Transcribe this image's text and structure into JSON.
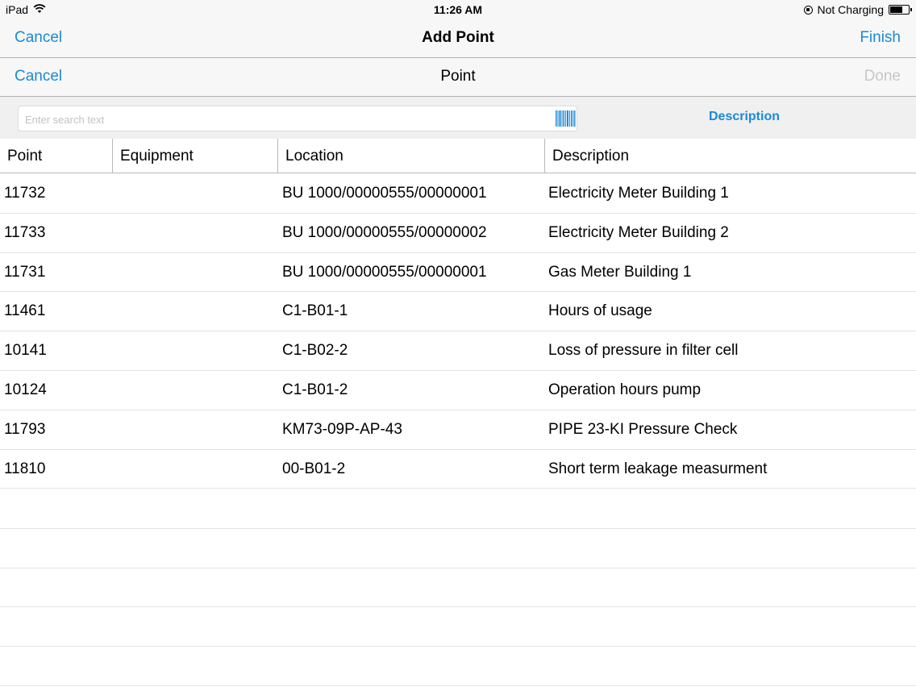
{
  "status_bar": {
    "device": "iPad",
    "time": "11:26 AM",
    "charging": "Not Charging",
    "icons": [
      "wifi-icon",
      "rotation-lock-icon",
      "battery-icon"
    ]
  },
  "nav_primary": {
    "left_button": "Cancel",
    "title": "Add Point",
    "right_button": "Finish"
  },
  "nav_secondary": {
    "left_button": "Cancel",
    "title": "Point",
    "right_button": "Done"
  },
  "search": {
    "placeholder": "Enter search text",
    "value": "",
    "scope_button": "Description",
    "scan_icon": "barcode-icon"
  },
  "table": {
    "columns": [
      "Point",
      "Equipment",
      "Location",
      "Description"
    ],
    "rows": [
      {
        "point": "11732",
        "equipment": "",
        "location": "BU 1000/00000555/00000001",
        "description": "Electricity Meter Building 1"
      },
      {
        "point": "11733",
        "equipment": "",
        "location": "BU 1000/00000555/00000002",
        "description": "Electricity Meter Building 2"
      },
      {
        "point": "11731",
        "equipment": "",
        "location": "BU 1000/00000555/00000001",
        "description": "Gas Meter Building 1"
      },
      {
        "point": "11461",
        "equipment": "",
        "location": "C1-B01-1",
        "description": "Hours of usage"
      },
      {
        "point": "10141",
        "equipment": "",
        "location": "C1-B02-2",
        "description": "Loss of pressure in filter cell"
      },
      {
        "point": "10124",
        "equipment": "",
        "location": "C1-B01-2",
        "description": "Operation hours pump"
      },
      {
        "point": "11793",
        "equipment": "",
        "location": "KM73-09P-AP-43",
        "description": "PIPE 23-KI Pressure Check"
      },
      {
        "point": "11810",
        "equipment": "",
        "location": "00-B01-2",
        "description": "Short term leakage measurment"
      }
    ]
  },
  "colors": {
    "accent": "#1a8ad6",
    "disabled": "#c7c7cc",
    "bar_background": "#f7f7f7"
  }
}
